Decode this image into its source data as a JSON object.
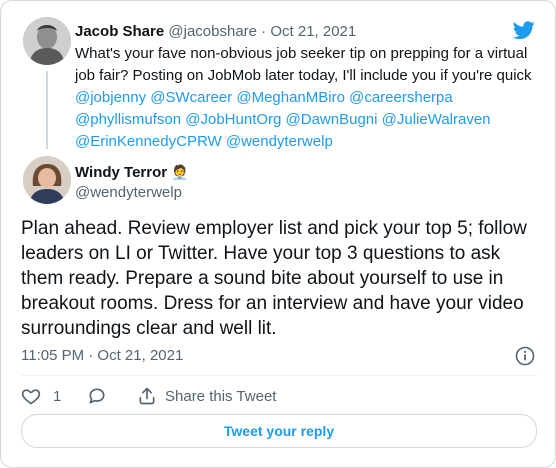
{
  "quoted_tweet": {
    "author_name": "Jacob Share",
    "author_handle": "@jacobshare",
    "separator": " · ",
    "date": "Oct 21, 2021",
    "text": "What's your fave non-obvious job seeker tip on prepping for a virtual job fair? Posting on JobMob later today, I'll include you if you're quick",
    "mentions": "@jobjenny @SWcareer @MeghanMBiro @careersherpa @phyllismufson @JobHuntOrg @DawnBugni @JulieWalraven @ErinKennedyCPRW @wendyterwelp"
  },
  "main_tweet": {
    "author_name": "Windy Terror",
    "author_emoji": "🧑‍💼",
    "author_handle": "@wendyterwelp",
    "text": "Plan ahead. Review employer list and pick your top 5; follow leaders on LI or Twitter. Have your top 3 questions to ask them ready. Prepare a sound bite about yourself to use in breakout rooms. Dress for an interview and have your video surroundings clear and well lit.",
    "timestamp": "11:05 PM · Oct 21, 2021"
  },
  "actions": {
    "like_count": "1",
    "share_label": "Share this Tweet"
  },
  "reply_button_label": "Tweet your reply",
  "icons": {
    "brand": "twitter-bird-icon",
    "info": "info-icon",
    "like": "heart-icon",
    "reply": "reply-bubble-icon",
    "share": "share-icon"
  },
  "colors": {
    "accent": "#1d9bf0",
    "text": "#0f1419",
    "secondary": "#536471",
    "border": "#cfd9de"
  }
}
